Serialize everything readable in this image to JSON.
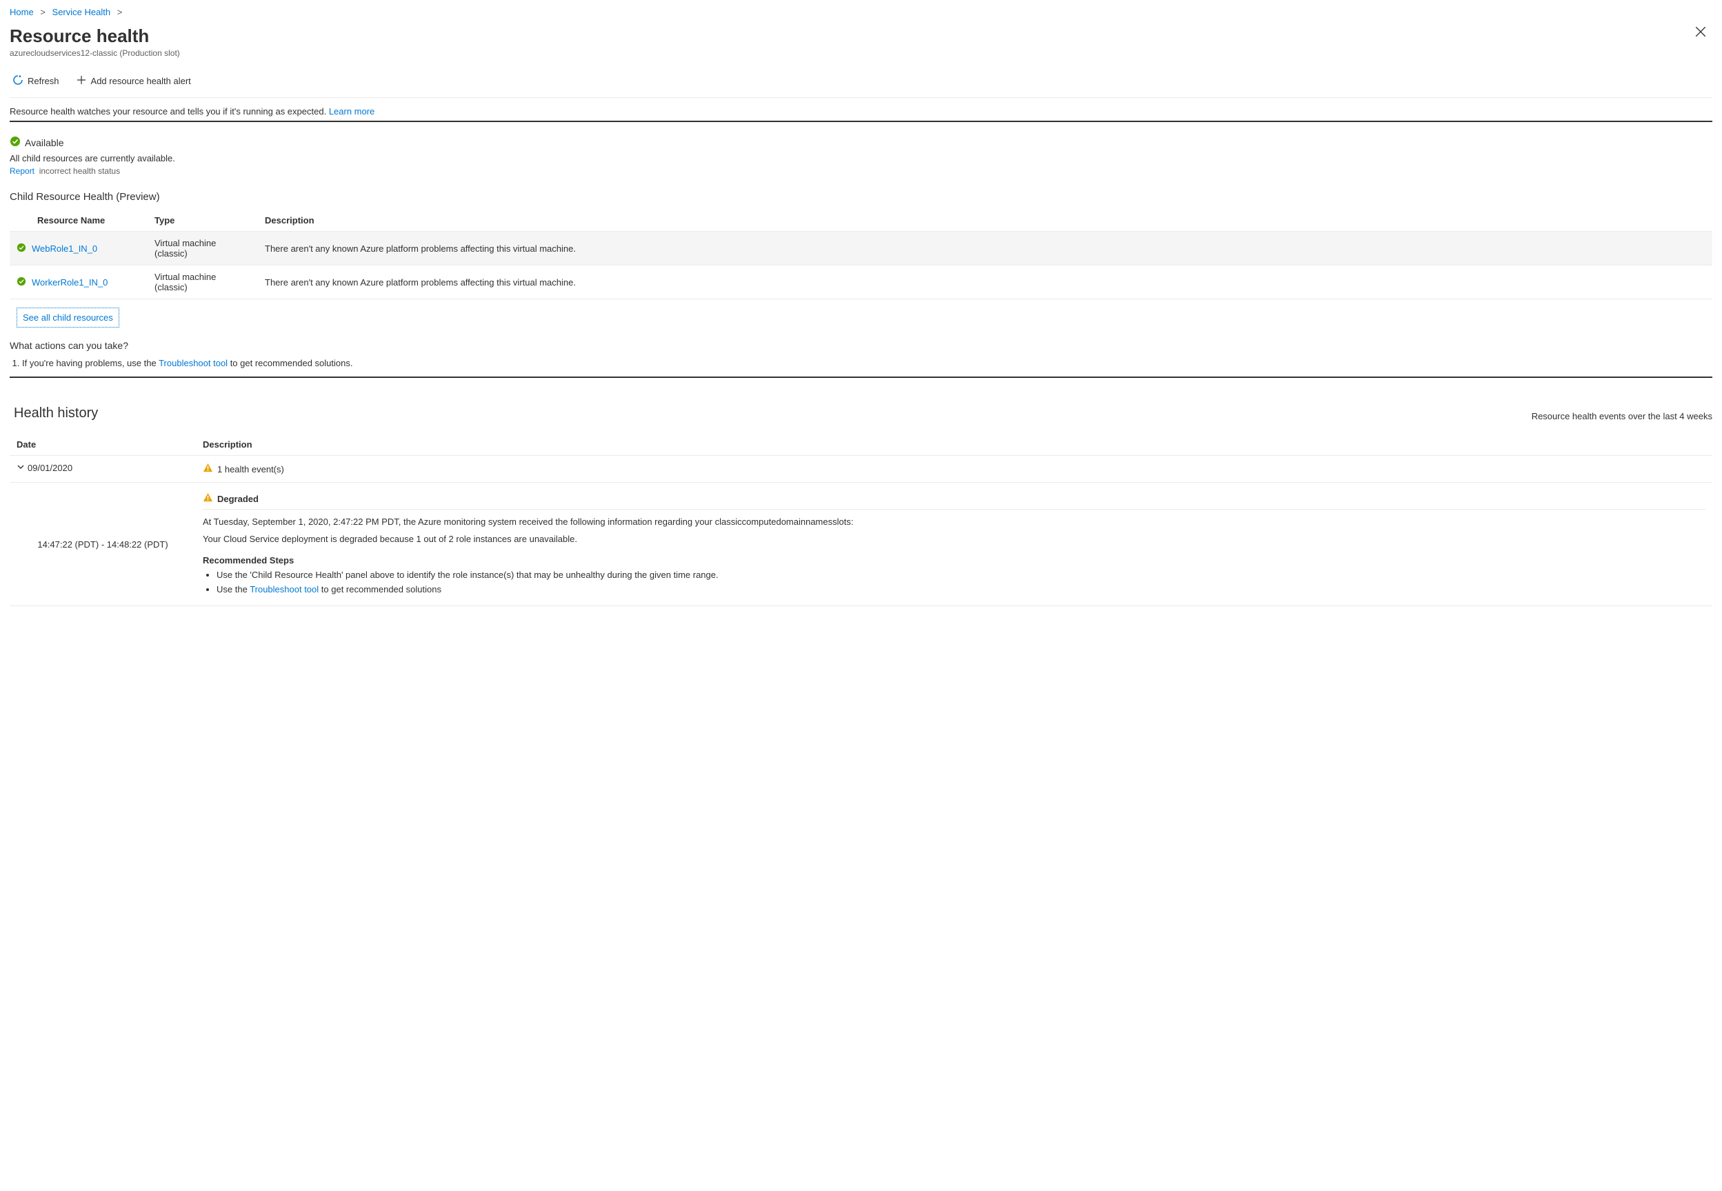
{
  "breadcrumbs": {
    "items": [
      "Home",
      "Service Health"
    ],
    "sep": ">"
  },
  "title": "Resource health",
  "subtitle": "azurecloudservices12-classic (Production slot)",
  "toolbar": {
    "refresh_label": "Refresh",
    "add_alert_label": "Add resource health alert"
  },
  "intro": {
    "text": "Resource health watches your resource and tells you if it's running as expected.",
    "learn_more": "Learn more"
  },
  "status": {
    "label": "Available",
    "sub": "All child resources are currently available.",
    "report_link": "Report",
    "report_suffix": "incorrect health status"
  },
  "child_health": {
    "heading": "Child Resource Health (Preview)",
    "columns": {
      "name": "Resource Name",
      "type": "Type",
      "desc": "Description"
    },
    "rows": [
      {
        "name": "WebRole1_IN_0",
        "type": "Virtual machine (classic)",
        "desc": "There aren't any known Azure platform problems affecting this virtual machine."
      },
      {
        "name": "WorkerRole1_IN_0",
        "type": "Virtual machine (classic)",
        "desc": "There aren't any known Azure platform problems affecting this virtual machine."
      }
    ],
    "see_all": "See all child resources"
  },
  "actions": {
    "heading": "What actions can you take?",
    "item1_prefix": "If you're having problems, use the ",
    "item1_link": "Troubleshoot tool",
    "item1_suffix": " to get recommended solutions."
  },
  "history": {
    "heading": "Health history",
    "sub": "Resource health events over the last 4 weeks",
    "columns": {
      "date": "Date",
      "desc": "Description"
    },
    "date": "09/01/2020",
    "summary": "1 health event(s)",
    "event": {
      "time_range": "14:47:22 (PDT) - 14:48:22 (PDT)",
      "title": "Degraded",
      "line1": "At Tuesday, September 1, 2020, 2:47:22 PM PDT, the Azure monitoring system received the following information regarding your classiccomputedomainnamesslots:",
      "line2": "Your Cloud Service deployment is degraded because 1 out of 2 role instances are unavailable.",
      "rec_heading": "Recommended Steps",
      "steps": {
        "s1": "Use the 'Child Resource Health' panel above to identify the role instance(s) that may be unhealthy during the given time range.",
        "s2_prefix": "Use the ",
        "s2_link": "Troubleshoot tool",
        "s2_suffix": " to get recommended solutions"
      }
    }
  }
}
